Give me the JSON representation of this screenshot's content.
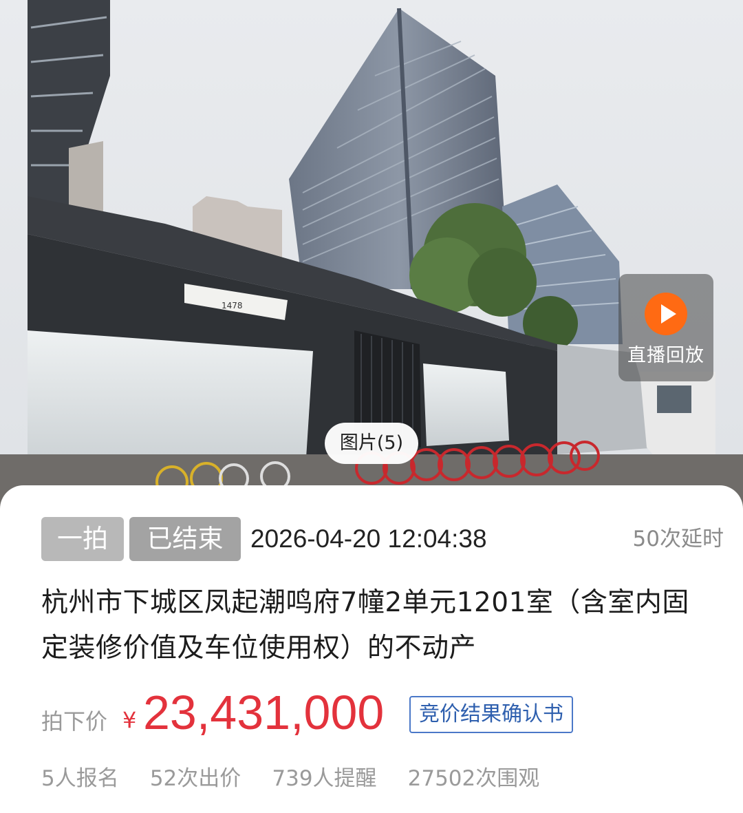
{
  "media": {
    "live_replay_label": "直播回放",
    "photo_count_label": "图片(5)",
    "sign_number": "1478"
  },
  "auction": {
    "round_tag": "一拍",
    "status_tag": "已结束",
    "end_time": "2026-04-20 12:04:38",
    "delay_count": "50次延时",
    "title": "杭州市下城区凤起潮鸣府7幢2单元1201室（含室内固定装修价值及车位使用权）的不动产",
    "price_label": "拍下价",
    "currency_symbol": "¥",
    "final_price": "23,431,000",
    "confirmation_link": "竞价结果确认书",
    "stats": {
      "registrations": "5人报名",
      "bids": "52次出价",
      "reminders": "739人提醒",
      "views": "27502次围观"
    }
  },
  "colors": {
    "price_red": "#e3323c",
    "link_blue": "#2e5fae",
    "live_orange": "#ff6a13",
    "tag_gray": "#a3a3a3"
  }
}
